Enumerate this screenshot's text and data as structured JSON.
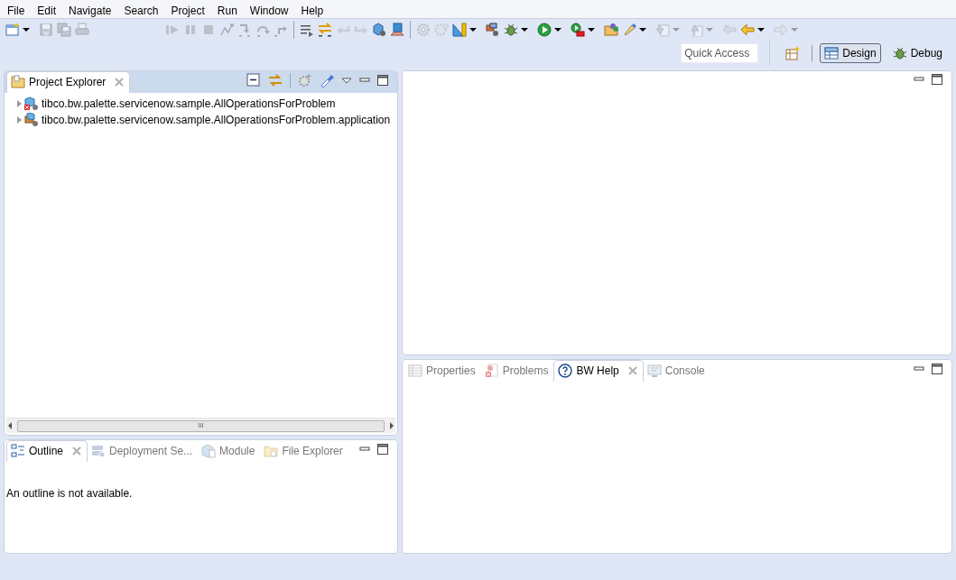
{
  "menu": [
    "File",
    "Edit",
    "Navigate",
    "Search",
    "Project",
    "Run",
    "Window",
    "Help"
  ],
  "toolbar": [
    [
      {
        "disabled": false,
        "dropdown": true
      },
      {
        "disabled": true,
        "dropdown": false
      },
      {
        "disabled": true,
        "dropdown": false
      },
      {
        "disabled": true,
        "dropdown": false
      }
    ],
    [
      {
        "disabled": true,
        "dropdown": false
      },
      {
        "disabled": true,
        "dropdown": false
      },
      {
        "disabled": true,
        "dropdown": false
      },
      {
        "disabled": true,
        "dropdown": false
      },
      {
        "disabled": true,
        "dropdown": false
      },
      {
        "disabled": true,
        "dropdown": false
      },
      {
        "disabled": true,
        "dropdown": false
      }
    ],
    [
      {
        "disabled": false,
        "dropdown": false
      },
      {
        "disabled": false,
        "dropdown": false
      },
      {
        "disabled": true,
        "dropdown": false
      },
      {
        "disabled": true,
        "dropdown": false
      },
      {
        "disabled": false,
        "dropdown": false
      },
      {
        "disabled": false,
        "dropdown": false
      }
    ],
    [
      {
        "disabled": true,
        "dropdown": false
      },
      {
        "disabled": true,
        "dropdown": false
      },
      {
        "disabled": false,
        "dropdown": true
      },
      {
        "disabled": false,
        "dropdown": false
      },
      {
        "disabled": false,
        "dropdown": true
      },
      {
        "disabled": false,
        "dropdown": true
      },
      {
        "disabled": false,
        "dropdown": true
      },
      {
        "disabled": false,
        "dropdown": false
      },
      {
        "disabled": false,
        "dropdown": true
      },
      {
        "disabled": true,
        "dropdown": true
      },
      {
        "disabled": true,
        "dropdown": true
      },
      {
        "disabled": true,
        "dropdown": false
      },
      {
        "disabled": false,
        "dropdown": true
      },
      {
        "disabled": true,
        "dropdown": true
      }
    ]
  ],
  "quick_access": {
    "placeholder": "Quick Access"
  },
  "perspectives": [
    {
      "label": "Design",
      "selected": true
    },
    {
      "label": "Debug",
      "selected": false
    }
  ],
  "project_explorer": {
    "tabs": [
      {
        "label": "Project Explorer",
        "selected": true
      }
    ],
    "tree": [
      {
        "label": "tibco.bw.palette.servicenow.sample.AllOperationsForProblem",
        "kind": "module",
        "expanded": false
      },
      {
        "label": "tibco.bw.palette.servicenow.sample.AllOperationsForProblem.application",
        "kind": "application",
        "expanded": false
      }
    ],
    "scrollbar_thumb": "III"
  },
  "outline": {
    "tabs": [
      {
        "label": "Outline",
        "selected": true
      },
      {
        "label": "Deployment Se...",
        "selected": false
      },
      {
        "label": "Module",
        "selected": false
      },
      {
        "label": "File Explorer",
        "selected": false
      }
    ],
    "message": "An outline is not available."
  },
  "bottom": {
    "tabs": [
      {
        "label": "Properties",
        "selected": false
      },
      {
        "label": "Problems",
        "selected": false
      },
      {
        "label": "BW Help",
        "selected": true
      },
      {
        "label": "Console",
        "selected": false
      }
    ]
  }
}
